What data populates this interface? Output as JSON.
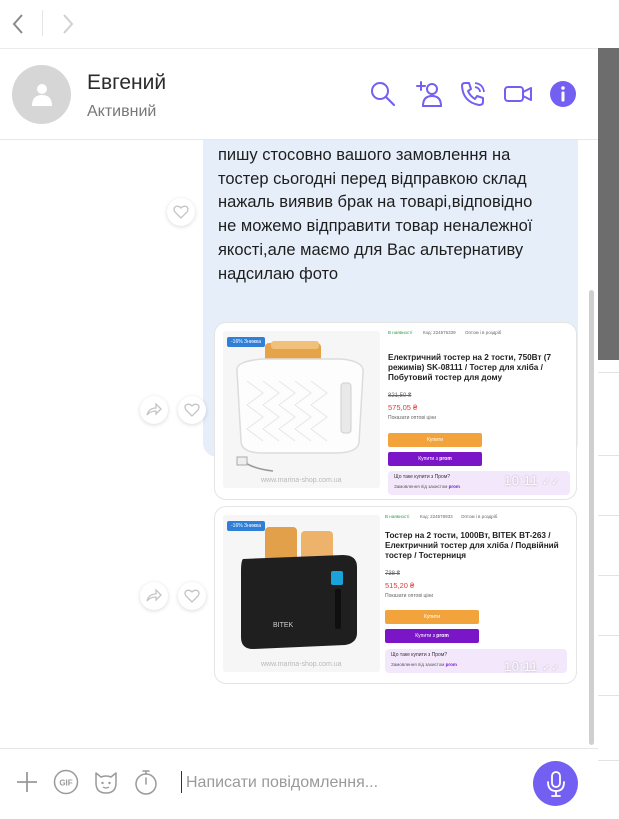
{
  "nav": {
    "back_icon": "chevron-left-icon",
    "forward_icon": "chevron-right-icon"
  },
  "header": {
    "name": "Евгений",
    "status": "Активний",
    "icons": [
      "search-icon",
      "add-participant-icon",
      "call-icon",
      "video-call-icon",
      "info-icon"
    ]
  },
  "colors": {
    "accent": "#7360f2",
    "bubble": "#e6eef9",
    "price_red": "#e53935",
    "buy_orange": "#f3a33c",
    "prom_purple": "#7a16c8"
  },
  "message": {
    "text": "пишу стосовно вашого замовлення на\nтостер сьогодні перед відправкою склад\nнажаль виявив брак на товарі,відповідно\nне можемо відправити товар неналежної\nякості,але маємо для Вас альтернативу\nнадсилаю фото"
  },
  "products": [
    {
      "badge": "-16% Знижка",
      "availability": "В наявності",
      "code": "Код: 224576339",
      "wholesale": "Оптом і в роздріб",
      "title": "Електричний тостер на 2 тости, 750Вт (7 режимів) SK-08111 / Тостер для хліба / Побутовий тостер для дому",
      "old_price": "821,50 ₴",
      "price": "575,05 ₴",
      "opt_price": "Показати оптові ціни",
      "buy": "Купити",
      "buy_prom": "Купити з",
      "prom_label": "prom",
      "question": "Що таке купити з Пром?",
      "protection": "Замовлення під захистом",
      "watermark": "www.marina-shop.com.ua",
      "time": "10:11"
    },
    {
      "badge": "-16% Знижка",
      "availability": "В наявності",
      "code": "Код: 224576933",
      "wholesale": "Оптом і в роздріб",
      "title": "Тостер на 2 тости, 1000Вт, BITEK BT-263 / Електричний тостер для хліба / Подвійний тостер / Тостерниця",
      "old_price": "738 ₴",
      "price": "515,20 ₴",
      "opt_price": "Показати оптові ціни",
      "buy": "Купити",
      "buy_prom": "Купити з",
      "prom_label": "prom",
      "question": "Що таке купити з Пром?",
      "protection": "Замовлення під захистом",
      "watermark": "www.marina-shop.com.ua",
      "brand": "BITEK",
      "time": "10:11"
    }
  ],
  "composer": {
    "placeholder": "Написати повідомлення...",
    "gif_label": "GIF",
    "icons": [
      "plus-icon",
      "gif-icon",
      "sticker-icon",
      "timer-icon",
      "microphone-icon"
    ]
  }
}
